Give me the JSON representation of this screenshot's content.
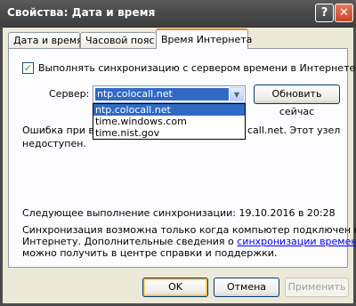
{
  "window": {
    "title": "Свойства: Дата и время",
    "help_icon": "?",
    "close_icon": "✕"
  },
  "tabs": [
    {
      "label": "Дата и время"
    },
    {
      "label": "Часовой пояс"
    },
    {
      "label": "Время Интернета"
    }
  ],
  "sync": {
    "checkbox_label": "Выполнять синхронизацию с сервером времени в Интернете",
    "checked": true,
    "check_glyph": "✓"
  },
  "server": {
    "label": "Сервер:",
    "value": "ntp.colocall.net",
    "arrow_icon": "▼",
    "options": [
      "ntp.colocall.net",
      "time.windows.com",
      "time.nist.gov"
    ],
    "update_button": "Обновить сейчас"
  },
  "error": {
    "line1_start": "Ошибка при вы",
    "line1_end": "call.net.  Этот узел",
    "line2": "недоступен."
  },
  "next_sync": "Следующее выполнение синхронизации: 19.10.2016 в 20:28",
  "info": {
    "line1": "Синхронизация возможна только когда компьютер подключен к",
    "line2_start": "Интернету. Дополнительные сведения о ",
    "link": "синхронизации времени",
    "line3": "можно получить в центре справки и поддержки."
  },
  "buttons": {
    "ok": "OK",
    "cancel": "Отмена",
    "apply": "Применить"
  }
}
